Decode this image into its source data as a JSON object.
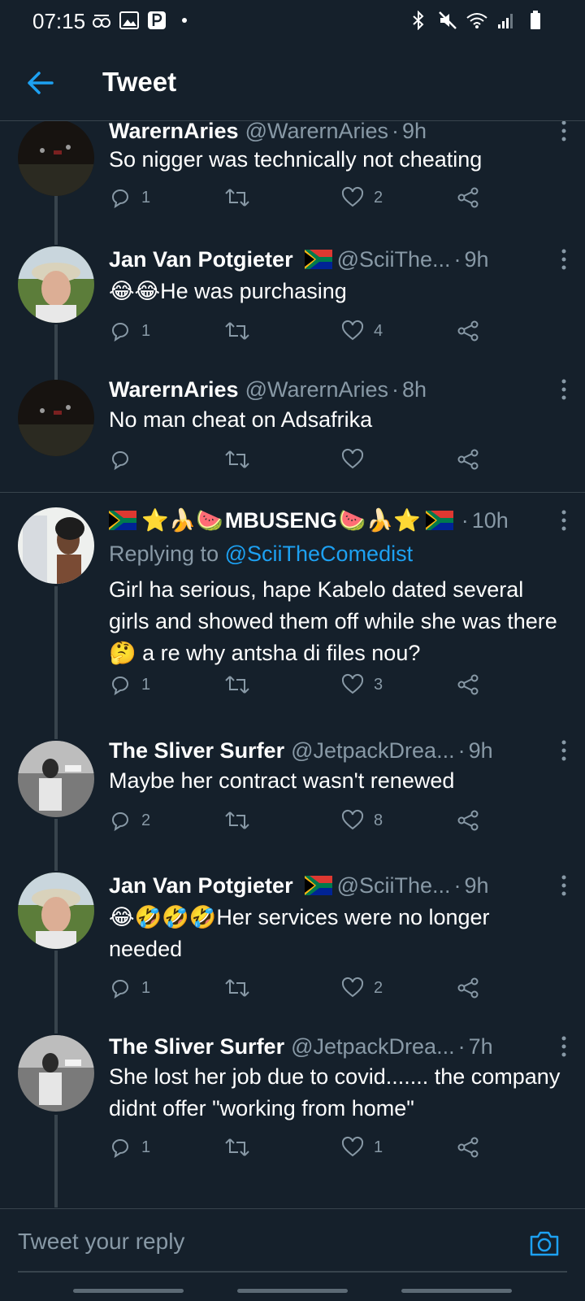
{
  "status_bar": {
    "time": "07:15",
    "left_icons": [
      "signal-sync-icon",
      "gallery-icon",
      "parking-icon",
      "dot-icon"
    ],
    "right_icons": [
      "bluetooth-icon",
      "mute-icon",
      "wifi-icon",
      "cell-signal-icon",
      "battery-icon"
    ]
  },
  "header": {
    "title": "Tweet"
  },
  "tweets": [
    {
      "name": "WarernAries",
      "handle": "@WarernAries",
      "time": "9h",
      "text": "So nigger was technically not cheating",
      "replies": "1",
      "retweets": "",
      "likes": "2"
    },
    {
      "name": "Jan Van Potgieter",
      "name_flag": true,
      "handle": "@SciiThe...",
      "time": "9h",
      "emoji_prefix": "😂😂",
      "text": "He was purchasing",
      "replies": "1",
      "retweets": "",
      "likes": "4"
    },
    {
      "name": "WarernAries",
      "handle": "@WarernAries",
      "time": "8h",
      "text": "No man cheat on Adsafrika",
      "replies": "",
      "retweets": "",
      "likes": ""
    },
    {
      "name": "MBUSENG",
      "name_prefix": "⭐🍌🍉",
      "name_suffix": "🍉🍌⭐",
      "time": "10h",
      "reply_label": "Replying to",
      "reply_handle": "@SciiTheComedist",
      "text_a": "Girl ha serious, hape Kabelo dated several girls and showed them off while she was there",
      "emoji_inline": "🤔",
      "text_b": "a re why antsha di files nou?",
      "replies": "1",
      "retweets": "",
      "likes": "3"
    },
    {
      "name": "The Sliver Surfer",
      "handle": "@JetpackDrea...",
      "time": "9h",
      "text": "Maybe her contract wasn't renewed",
      "replies": "2",
      "retweets": "",
      "likes": "8"
    },
    {
      "name": "Jan Van Potgieter",
      "name_flag": true,
      "handle": "@SciiThe...",
      "time": "9h",
      "emoji_prefix": "😂🤣🤣🤣",
      "text": "Her services were no longer needed",
      "replies": "1",
      "retweets": "",
      "likes": "2"
    },
    {
      "name": "The Sliver Surfer",
      "handle": "@JetpackDrea...",
      "time": "7h",
      "text": "She lost her job due to covid....... the company didnt offer \"working from home\"",
      "replies": "1",
      "retweets": "",
      "likes": "1"
    }
  ],
  "reply_bar": {
    "placeholder": "Tweet your reply"
  },
  "colors": {
    "background": "#15202b",
    "accent": "#1da1f2",
    "secondary_text": "#8899a6",
    "divider": "#38444d"
  }
}
